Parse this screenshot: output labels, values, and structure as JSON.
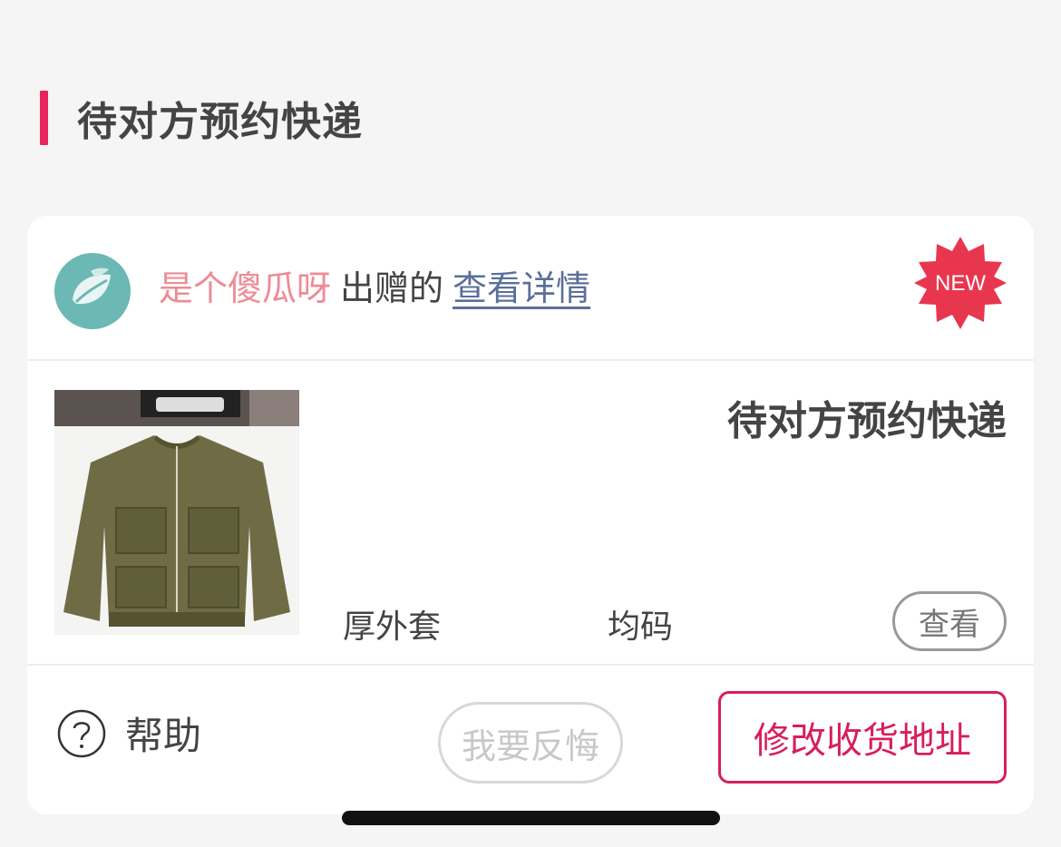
{
  "section": {
    "title": "待对方预约快递"
  },
  "card": {
    "giver_name": "是个傻瓜呀",
    "gave_text": "出赠的",
    "detail_link": "查看详情",
    "new_badge": "NEW",
    "status": "待对方预约快递",
    "item_name": "厚外套",
    "item_size": "均码",
    "view_button": "查看",
    "help_label": "帮助",
    "regret_button": "我要反悔",
    "address_button": "修改收货地址"
  },
  "colors": {
    "accent": "#e8245b",
    "giver_name": "#ee8b94",
    "link": "#5b6f98",
    "avatar_bg": "#6bb8b4"
  }
}
